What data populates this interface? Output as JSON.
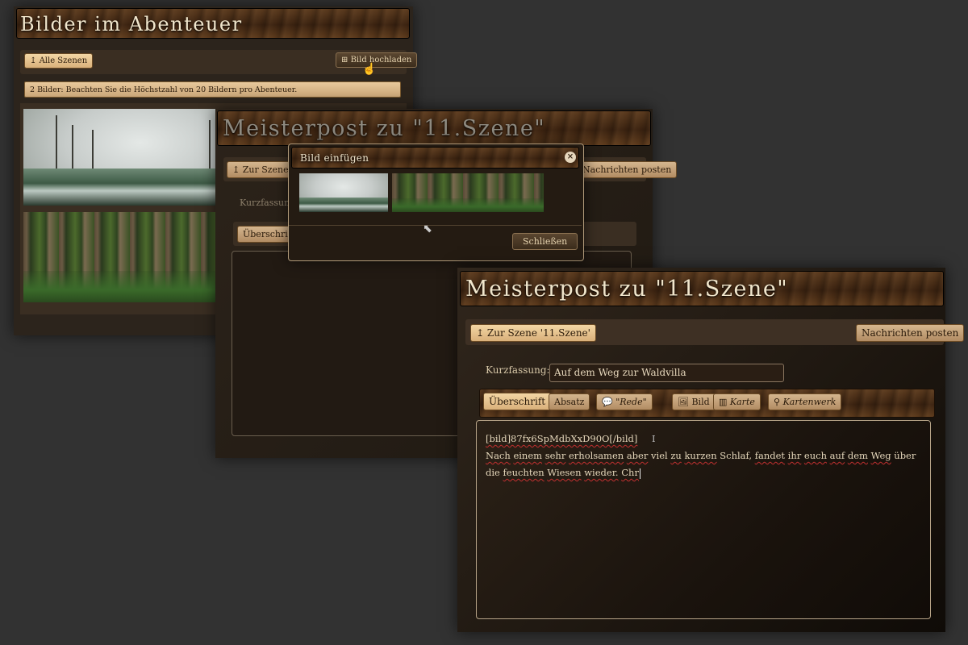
{
  "window1": {
    "title": "Bilder im Abenteuer",
    "all_scenes_button": "Alle Szenen",
    "upload_button": "Bild hochladen",
    "notice": "2 Bilder: Beachten Sie die Höchstzahl von 20 Bildern pro Abenteuer."
  },
  "window2": {
    "title": "Meisterpost zu \"11.Szene\"",
    "back_button": "Zur Szene",
    "post_button": "Nachrichten posten",
    "summary_label": "Kurzfassung",
    "heading_button": "Überschrift"
  },
  "modal": {
    "title": "Bild einfügen",
    "close_button": "Schließen"
  },
  "window3": {
    "title": "Meisterpost zu \"11.Szene\"",
    "back_button": "Zur Szene '11.Szene'",
    "post_button": "Nachrichten posten",
    "summary_label": "Kurzfassung:",
    "summary_value": "Auf dem Weg zur Waldvilla",
    "toolbar": {
      "heading": "Überschrift",
      "paragraph": "Absatz",
      "speech": "\"Rede\"",
      "image": "Bild",
      "map": "Karte",
      "mapwork": "Kartenwerk"
    },
    "editor": {
      "line1": "[bild]87fx6SpMdbXxD90O[/bild]",
      "line2_words": [
        "Nach",
        "einem",
        "sehr",
        "erholsamen",
        "aber",
        "viel",
        "zu",
        "kurzen",
        "Schlaf,",
        "fandet",
        "ihr",
        "euch",
        "auf",
        "dem",
        "Weg",
        "über"
      ],
      "line3_words": [
        "die",
        "feuchten",
        "Wiesen",
        "wieder.",
        "Chr"
      ]
    }
  },
  "colors": {
    "background": "#323232",
    "button_tan": "#e8c690",
    "title_text": "#f1e6cc"
  }
}
